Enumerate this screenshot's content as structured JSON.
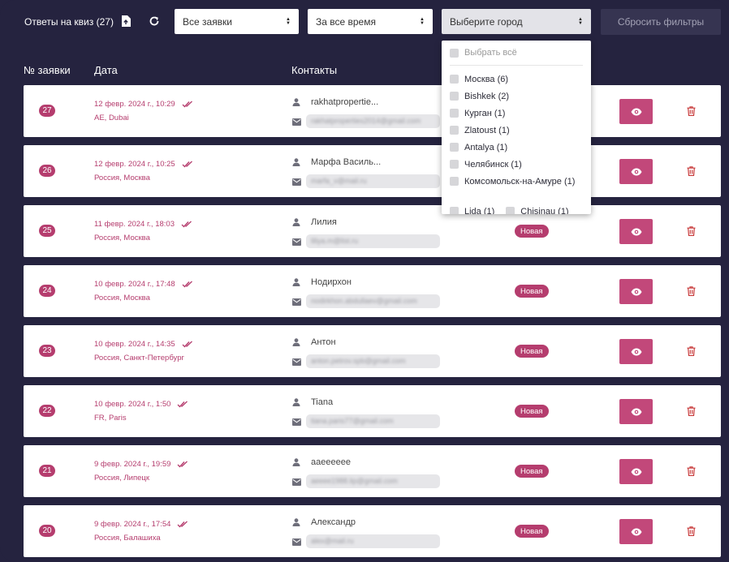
{
  "topbar": {
    "title": "Ответы на квиз (27)",
    "export_icon": "file-export-icon",
    "refresh_icon": "refresh-icon",
    "filter_status": "Все заявки",
    "filter_period": "За все время",
    "filter_city_placeholder": "Выберите город",
    "reset_label": "Сбросить фильтры"
  },
  "headers": {
    "number": "№ заявки",
    "date": "Дата",
    "contacts": "Контакты"
  },
  "city_dropdown": {
    "select_all": "Выбрать всё",
    "items": [
      "Москва (6)",
      "Bishkek (2)",
      "Курган (1)",
      "Zlatoust (1)",
      "Antalya (1)",
      "Челябинск (1)",
      "Комсомольск-на-Амуре (1)"
    ],
    "partial_row": [
      "Lida (1)",
      "Chisinau (1)"
    ]
  },
  "rows": [
    {
      "num": "27",
      "date": "12 февр. 2024 г., 10:29",
      "location": "AE, Dubai",
      "name": "rakhatpropertie...",
      "email": "rakhatproperties2014@gmail.com",
      "status": ""
    },
    {
      "num": "26",
      "date": "12 февр. 2024 г., 10:25",
      "location": "Россия, Москва",
      "name": "Марфа Василь...",
      "email": "marfa_v@mail.ru",
      "status": ""
    },
    {
      "num": "25",
      "date": "11 февр. 2024 г., 18:03",
      "location": "Россия, Москва",
      "name": "Лилия",
      "email": "liliya.m@list.ru",
      "status": "Новая"
    },
    {
      "num": "24",
      "date": "10 февр. 2024 г., 17:48",
      "location": "Россия, Москва",
      "name": "Нодирхон",
      "email": "nodirkhon.abdullaev@gmail.com",
      "status": "Новая"
    },
    {
      "num": "23",
      "date": "10 февр. 2024 г., 14:35",
      "location": "Россия, Санкт-Петербург",
      "name": "Антон",
      "email": "anton.petrov.spb@gmail.com",
      "status": "Новая"
    },
    {
      "num": "22",
      "date": "10 февр. 2024 г., 1:50",
      "location": "FR, Paris",
      "name": "Tiana",
      "email": "tiana.paris77@gmail.com",
      "status": "Новая"
    },
    {
      "num": "21",
      "date": "9 февр. 2024 г., 19:59",
      "location": "Россия, Липецк",
      "name": "ааееееее",
      "email": "aeeee1988.lip@gmail.com",
      "status": "Новая"
    },
    {
      "num": "20",
      "date": "9 февр. 2024 г., 17:54",
      "location": "Россия, Балашиха",
      "name": "Александр",
      "email": "alex@mail.ru",
      "status": "Новая"
    }
  ],
  "colors": {
    "background": "#25233f",
    "accent": "#b53d6e",
    "button": "#c2487a",
    "delete": "#c83a3a"
  }
}
